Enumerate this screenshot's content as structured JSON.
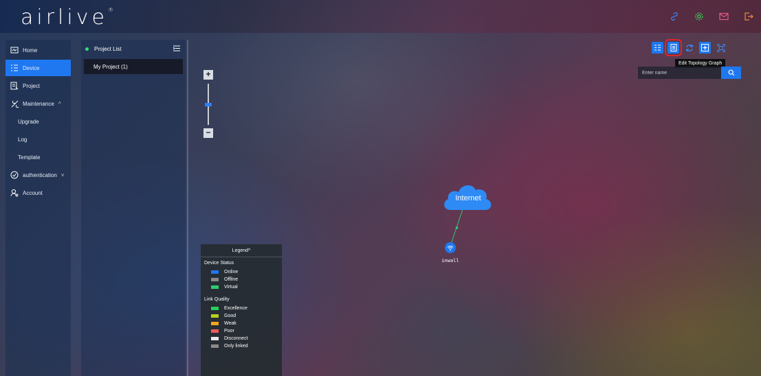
{
  "header": {
    "logo_text": "airlive",
    "logo_mark": "®",
    "icons": [
      "link-icon",
      "settings-icon",
      "mail-icon",
      "logout-icon"
    ]
  },
  "sidebar": {
    "items": [
      {
        "label": "Home",
        "icon": "home-icon"
      },
      {
        "label": "Device",
        "icon": "device-list-icon",
        "active": true
      },
      {
        "label": "Project",
        "icon": "project-icon"
      },
      {
        "label": "Maintenance",
        "icon": "tools-icon",
        "chevron": "^"
      },
      {
        "label": "Upgrade"
      },
      {
        "label": "Log"
      },
      {
        "label": "Template"
      },
      {
        "label": "authentication",
        "icon": "shield-check-icon",
        "chevron": "˅"
      },
      {
        "label": "Account",
        "icon": "account-icon"
      }
    ]
  },
  "project_panel": {
    "title": "Project List",
    "items": [
      "My Project (1)"
    ]
  },
  "topology": {
    "search_placeholder": "Enter name",
    "tooltip": "Edit Topology Graph",
    "zoom_plus": "+",
    "zoom_minus": "−",
    "cloud_label": "Internet",
    "device_label": "inwall"
  },
  "legend": {
    "title": "Legend",
    "toggle": "^",
    "device_status_title": "Device Status",
    "device_status": [
      {
        "label": "Online",
        "color": "#1f78f0"
      },
      {
        "label": "Offline",
        "color": "#8a8a8a"
      },
      {
        "label": "Virtual",
        "color": "#2ecc71"
      }
    ],
    "link_quality_title": "Link Quality",
    "link_quality": [
      {
        "label": "Excellence",
        "color": "#22d15c"
      },
      {
        "label": "Good",
        "color": "#b8d21a"
      },
      {
        "label": "Weak",
        "color": "#f3a51b"
      },
      {
        "label": "Poor",
        "color": "#ef5a5a"
      },
      {
        "label": "Disconnect",
        "color": "#e8e8e8"
      },
      {
        "label": "Only linked",
        "color": "#8a8a8a"
      }
    ]
  },
  "colors": {
    "accent": "#1f78f0",
    "highlight": "#e0262b"
  }
}
